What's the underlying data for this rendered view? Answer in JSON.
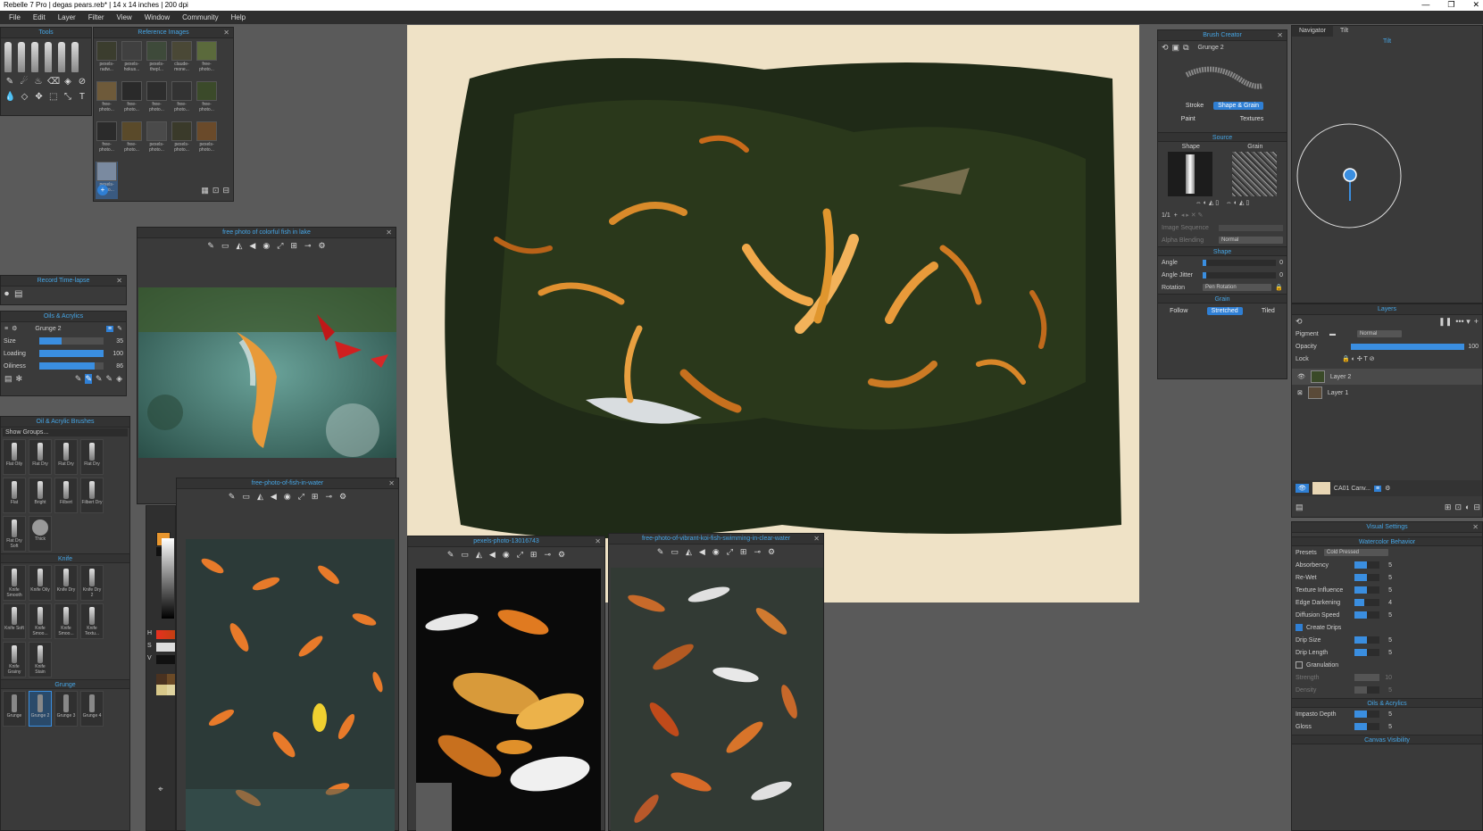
{
  "app": {
    "title": "Rebelle 7 Pro | degas pears.reb* | 14 x 14 inches | 200 dpi",
    "window_buttons": [
      "—",
      "❐",
      "✕"
    ]
  },
  "menu": [
    "File",
    "Edit",
    "Layer",
    "Filter",
    "View",
    "Window",
    "Community",
    "Help"
  ],
  "tools_panel": {
    "title": "Tools"
  },
  "reference_images": {
    "title": "Reference Images",
    "thumbs": [
      "pexels-radw...",
      "pexels-hokus...",
      "pexels-thepl...",
      "claude-mone...",
      "free-photo...",
      "free-photo...",
      "free-photo...",
      "free-photo...",
      "free-photo...",
      "free-photo...",
      "free-photo...",
      "free-photo...",
      "pexels-photo...",
      "pexels-photo...",
      "pexels-photo...",
      "pexels-photo..."
    ]
  },
  "ref_windows": {
    "fish_lake": "free photo of colorful fish in lake",
    "fish_water": "free-photo-of-fish-in-water",
    "pexels": "pexels-photo-13016743",
    "koi": "free-photo-of-vibrant-koi-fish-swimming-in-clear-water"
  },
  "record_panel": {
    "title": "Record Time-lapse"
  },
  "oils_panel": {
    "title": "Oils & Acrylics",
    "brush_name": "Grunge 2",
    "sliders": [
      {
        "label": "Size",
        "value": "35",
        "fraction": 0.3
      },
      {
        "label": "Loading",
        "value": "100",
        "fraction": 1.0
      },
      {
        "label": "Oiliness",
        "value": "86",
        "fraction": 0.86
      }
    ]
  },
  "brushes_panel": {
    "title": "Oil & Acrylic Brushes",
    "group_select": "Show Groups...",
    "row1": [
      "Flat Oily",
      "Flat Dry",
      "Flat Dry",
      "Flat Dry"
    ],
    "row2": [
      "Flat",
      "Bright",
      "Filbert",
      "Filbert Dry"
    ],
    "row3": [
      "Flat Dry Soft",
      "Thick"
    ],
    "knife_title": "Knife",
    "knife_row1": [
      "Knife Smooth",
      "Knife Oily",
      "Knife Dry",
      "Knife Dry 2"
    ],
    "knife_row2": [
      "Knife Soft",
      "Knife Smoo...",
      "Knife Smoo...",
      "Knife Textu..."
    ],
    "knife_row3": [
      "Knife Grainy",
      "Knife Stain"
    ],
    "grunge_title": "Grunge",
    "grunge_row": [
      "Grunge",
      "Grunge 2",
      "Grunge 3",
      "Grunge 4"
    ]
  },
  "color": {
    "H": "H",
    "S": "S",
    "V": "V",
    "primary": "#e8962e"
  },
  "brush_creator": {
    "title": "Brush Creator",
    "brush_name": "Grunge 2",
    "tabs": [
      "Stroke",
      "Shape & Grain",
      "Paint",
      "Textures"
    ],
    "source_title": "Source",
    "shape_label": "Shape",
    "grain_label": "Grain",
    "counter": "1/1",
    "image_sequence": "Image Sequence",
    "alpha_blending": "Alpha Blending",
    "alpha_value": "Normal",
    "shape_section": "Shape",
    "angle": {
      "label": "Angle",
      "value": "0"
    },
    "angle_jitter": {
      "label": "Angle Jitter",
      "value": "0"
    },
    "rotation": {
      "label": "Rotation",
      "value": "Pen Rotation"
    },
    "grain_section": "Grain",
    "grain_modes": [
      "Follow",
      "Stretched",
      "Tiled"
    ]
  },
  "navigator": {
    "tabs": [
      "Navigator",
      "Tilt"
    ],
    "tilt_label": "Tilt"
  },
  "layers": {
    "title": "Layers",
    "pigment_label": "Pigment",
    "blend": "Normal",
    "opacity_label": "Opacity",
    "opacity": "100",
    "lock_label": "Lock",
    "items": [
      "Layer 2",
      "Layer 1"
    ],
    "canvas_name": "CA01 Canv..."
  },
  "visual_settings": {
    "title": "Visual Settings",
    "watercolor_title": "Watercolor Behavior",
    "presets_label": "Presets",
    "presets_value": "Cold Pressed",
    "rows": [
      {
        "label": "Absorbency",
        "value": "5"
      },
      {
        "label": "Re-Wet",
        "value": "5"
      },
      {
        "label": "Texture Influence",
        "value": "5"
      },
      {
        "label": "Edge Darkening",
        "value": "4"
      },
      {
        "label": "Diffusion Speed",
        "value": "5"
      }
    ],
    "create_drips": "Create Drips",
    "drip_rows": [
      {
        "label": "Drip Size",
        "value": "5"
      },
      {
        "label": "Drip Length",
        "value": "5"
      }
    ],
    "granulation": "Granulation",
    "gran_rows": [
      {
        "label": "Strength",
        "value": "10"
      },
      {
        "label": "Density",
        "value": "5"
      }
    ],
    "oils_title": "Oils & Acrylics",
    "oil_rows": [
      {
        "label": "Impasto Depth",
        "value": "5"
      },
      {
        "label": "Gloss",
        "value": "5"
      }
    ],
    "canvas_visibility": "Canvas Visibility"
  }
}
